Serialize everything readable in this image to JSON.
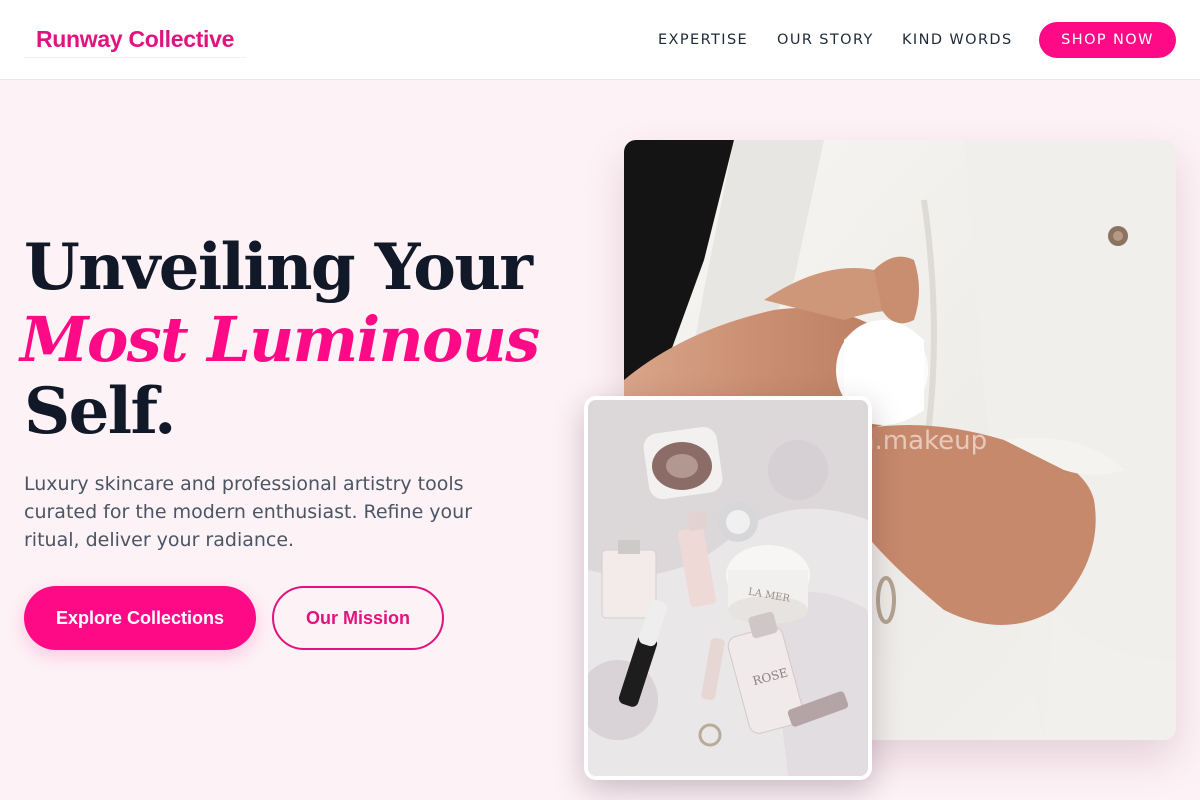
{
  "header": {
    "logo": "Runway Collective",
    "nav": [
      "EXPERTISE",
      "OUR STORY",
      "KIND WORDS"
    ],
    "cta": "SHOP NOW"
  },
  "hero": {
    "title_line1": "Unveiling Your",
    "title_line2": "Most Luminous",
    "title_line3": "Self.",
    "subtitle": "Luxury skincare and professional artistry tools curated for the modern enthusiast. Refine your ritual, deliver your radiance.",
    "primary_button": "Explore Collections",
    "secondary_button": "Our Mission"
  },
  "images": {
    "main_watermark": "n.makeup",
    "product_labels": [
      "LA MER",
      "ROSE"
    ]
  },
  "colors": {
    "accent": "#ff0a86",
    "background": "#fdf2f6",
    "text": "#111827"
  }
}
